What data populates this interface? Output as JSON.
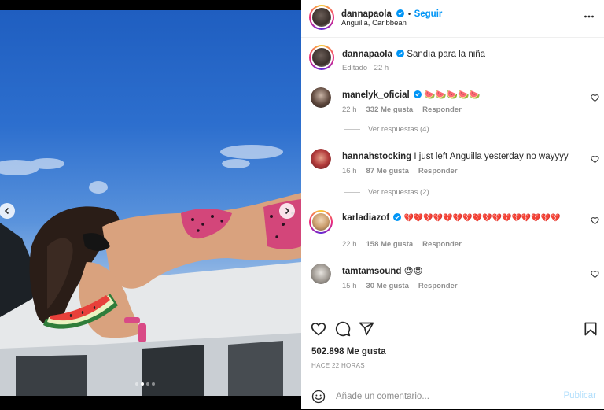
{
  "header": {
    "username": "dannapaola",
    "follow_label": "Seguir",
    "location": "Anguilla, Caribbean"
  },
  "caption": {
    "username": "dannapaola",
    "text": "Sandía para la niña",
    "meta": "Editado · 22 h"
  },
  "comments": [
    {
      "username": "manelyk_oficial",
      "verified": true,
      "text": "🍉🍉🍉🍉🍉",
      "time": "22 h",
      "likes": "332 Me gusta",
      "reply_label": "Responder",
      "replies": "Ver respuestas (4)"
    },
    {
      "username": "hannahstocking",
      "verified": false,
      "text": "I just left Anguilla yesterday no wayyyy",
      "time": "16 h",
      "likes": "87 Me gusta",
      "reply_label": "Responder",
      "replies": "Ver respuestas (2)"
    },
    {
      "username": "karladiazof",
      "verified": true,
      "text": "💔💔💔💔💔💔💔💔💔💔💔💔💔💔💔💔",
      "time": "22 h",
      "likes": "158 Me gusta",
      "reply_label": "Responder"
    },
    {
      "username": "tamtamsound",
      "verified": false,
      "text": "😍😍",
      "time": "15 h",
      "likes": "30 Me gusta",
      "reply_label": "Responder"
    }
  ],
  "actions": {
    "likes": "502.898 Me gusta",
    "time_ago": "HACE 22 HORAS"
  },
  "comment_box": {
    "placeholder": "Añade un comentario...",
    "publish_label": "Publicar"
  },
  "carousel": {
    "slide_count": 4,
    "active_index": 1
  },
  "icons": {
    "more": "more-horizontal-icon",
    "like": "heart-icon",
    "comment": "comment-icon",
    "share": "send-icon",
    "save": "bookmark-icon",
    "emoji": "emoji-icon"
  },
  "colors": {
    "accent": "#0095f6",
    "publish_disabled": "#b2dffc",
    "verified": "#0095f6"
  }
}
